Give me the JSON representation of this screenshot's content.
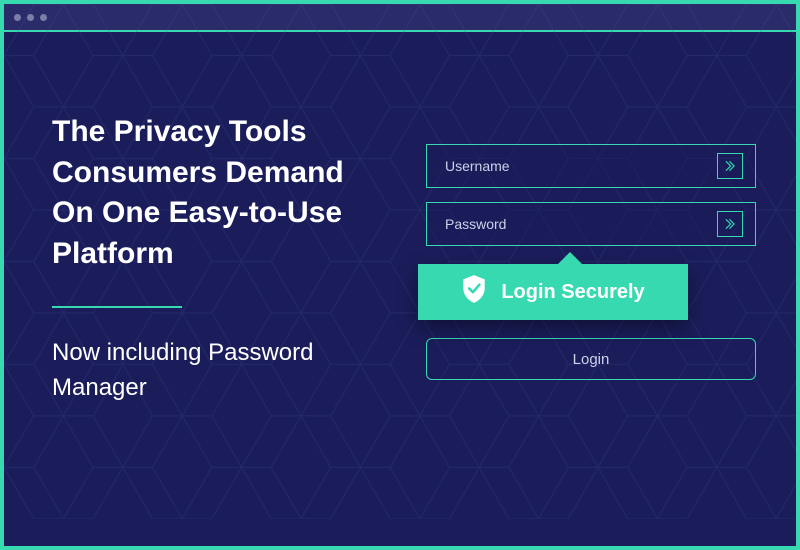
{
  "hero": {
    "headline": "The Privacy Tools Consumers Demand On One Easy-to-Use Platform",
    "subhead": "Now including Password Manager"
  },
  "form": {
    "username_placeholder": "Username",
    "password_placeholder": "Password",
    "login_button": "Login"
  },
  "tooltip": {
    "text": "Login Securely"
  },
  "colors": {
    "accent": "#36d9b0",
    "bg": "#1a1d5a"
  }
}
